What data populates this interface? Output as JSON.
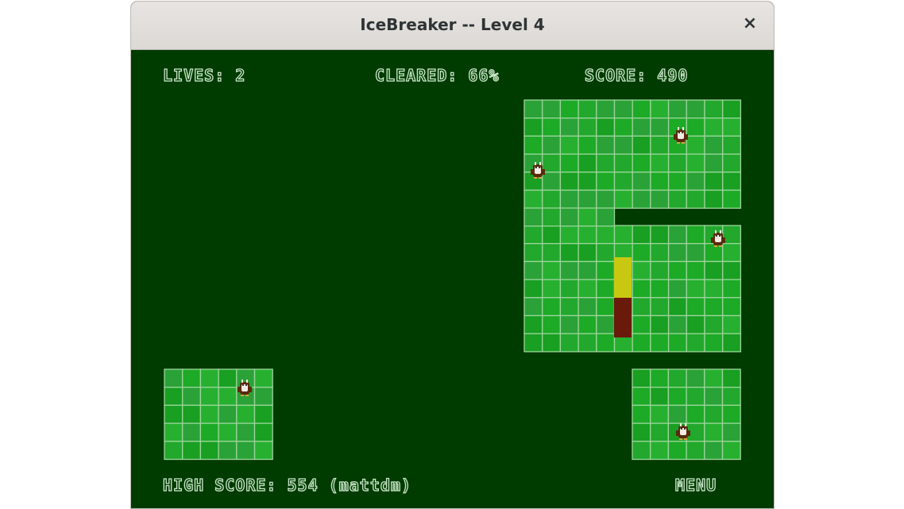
{
  "window": {
    "title": "IceBreaker -- Level 4",
    "close_glyph": "×"
  },
  "hud": {
    "lives": "LIVES: 2",
    "cleared": "CLEARED: 66%",
    "score": "SCORE: 490",
    "high_score": "HIGH SCORE: 554 (mattdm)",
    "menu": "MENU"
  },
  "colors": {
    "cleared_area": "#003b00",
    "ice_tiles": [
      "#1daa26",
      "#22a82c",
      "#2aa237",
      "#199f22",
      "#27b030"
    ],
    "grid_line": "#9bd59b",
    "line_growing_up": "#c8c812",
    "line_growing_down": "#6a1a0a",
    "penguin_body": "#5a2a0c"
  },
  "icons": {
    "penguin": "penguin-icon"
  }
}
